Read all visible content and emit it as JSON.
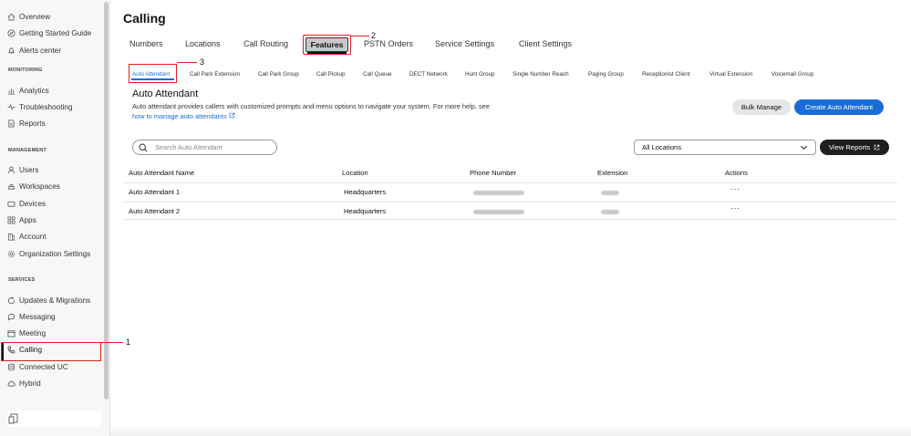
{
  "sidebar": {
    "top_items": [
      {
        "label": "Overview",
        "icon": "home-icon"
      },
      {
        "label": "Getting Started Guide",
        "icon": "compass-icon"
      },
      {
        "label": "Alerts center",
        "icon": "bell-icon"
      }
    ],
    "monitoring_title": "MONITORING",
    "monitoring_items": [
      {
        "label": "Analytics",
        "icon": "bar-chart-icon"
      },
      {
        "label": "Troubleshooting",
        "icon": "pulse-icon"
      },
      {
        "label": "Reports",
        "icon": "document-icon"
      }
    ],
    "management_title": "MANAGEMENT",
    "management_items": [
      {
        "label": "Users",
        "icon": "user-icon"
      },
      {
        "label": "Workspaces",
        "icon": "workspace-icon"
      },
      {
        "label": "Devices",
        "icon": "device-icon"
      },
      {
        "label": "Apps",
        "icon": "apps-icon"
      },
      {
        "label": "Account",
        "icon": "building-icon"
      },
      {
        "label": "Organization Settings",
        "icon": "gear-icon"
      }
    ],
    "services_title": "SERVICES",
    "services_items": [
      {
        "label": "Updates & Migrations",
        "icon": "refresh-icon"
      },
      {
        "label": "Messaging",
        "icon": "chat-icon"
      },
      {
        "label": "Meeting",
        "icon": "calendar-icon"
      },
      {
        "label": "Calling",
        "icon": "phone-icon"
      },
      {
        "label": "Connected UC",
        "icon": "database-icon"
      },
      {
        "label": "Hybrid",
        "icon": "cloud-icon"
      }
    ]
  },
  "callouts": {
    "one": "1",
    "two": "2",
    "three": "3"
  },
  "page_title": "Calling",
  "tabs": [
    "Numbers",
    "Locations",
    "Call Routing",
    "Features",
    "PSTN Orders",
    "Service Settings",
    "Client Settings"
  ],
  "active_tab": "Features",
  "subtabs": [
    "Auto Attendant",
    "Call Park Extension",
    "Call Park Group",
    "Call Pickup",
    "Call Queue",
    "DECT Network",
    "Hunt Group",
    "Single Number Reach",
    "Paging Group",
    "Receptionist Client",
    "Virtual Extension",
    "Voicemail Group"
  ],
  "active_subtab": "Auto Attendant",
  "section": {
    "title": "Auto Attendant",
    "description_prefix": "Auto attendant provides callers with customized prompts and menu options to navigate your system. For more help, see ",
    "description_link": "how to manage auto attendants"
  },
  "buttons": {
    "bulk": "Bulk Manage",
    "create": "Create Auto Attendant",
    "reports": "View Reports"
  },
  "search": {
    "placeholder": "Search Auto Attendant"
  },
  "location_filter": {
    "value": "All Locations"
  },
  "table": {
    "headers": [
      "Auto Attendant Name",
      "Location",
      "Phone Number",
      "Extension",
      "Actions"
    ],
    "rows": [
      {
        "name": "Auto Attendant 1",
        "location": "Headquarters",
        "actions": "···"
      },
      {
        "name": "Auto Attendant 2",
        "location": "Headquarters",
        "actions": "···"
      }
    ]
  },
  "colors": {
    "accent": "#1a6dd6",
    "callout": "#e02020",
    "dark_button": "#1f1f1f"
  }
}
